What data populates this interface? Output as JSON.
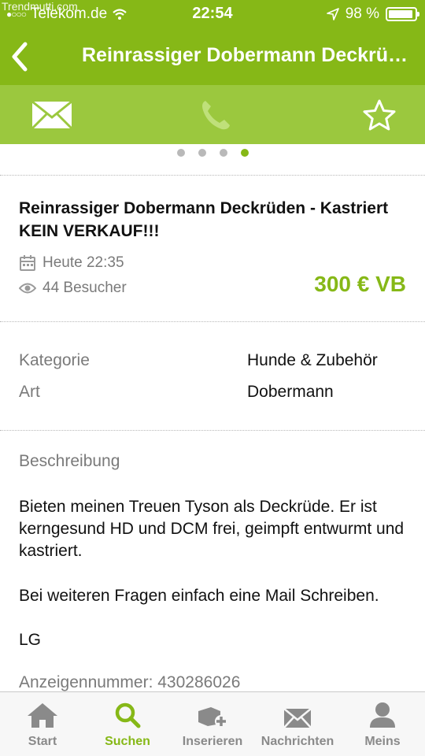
{
  "watermark": "Trendmutti.com",
  "status_bar": {
    "carrier": "Telekom.de",
    "time": "22:54",
    "battery": "98 %"
  },
  "header": {
    "title": "Reinrassiger Dobermann Deckrüden - Kastriert KEIN VERKAUF!!!"
  },
  "action_bar": {
    "icons": [
      "mail-icon",
      "phone-icon",
      "star-icon"
    ]
  },
  "pager": {
    "count": 4,
    "active": 4
  },
  "listing": {
    "title": "Reinrassiger Dobermann Deckrüden - Kastriert KEIN VERKAUF!!!",
    "date": "Heute 22:35",
    "visitors": "44 Besucher",
    "price": "300 € VB"
  },
  "details": [
    {
      "label": "Kategorie",
      "value": "Hunde & Zubehör"
    },
    {
      "label": "Art",
      "value": "Dobermann"
    }
  ],
  "description": {
    "heading": "Beschreibung",
    "paragraph1": "Bieten meinen Treuen Tyson als Deckrüde. Er ist kerngesund HD und DCM frei, geimpft entwurmt und kastriert.",
    "paragraph2": "Bei weiteren Fragen einfach eine Mail Schreiben.",
    "paragraph3": "LG"
  },
  "ad_number": "Anzeigennummer: 430286026",
  "tabs": [
    {
      "label": "Start",
      "icon": "home-icon"
    },
    {
      "label": "Suchen",
      "icon": "search-icon"
    },
    {
      "label": "Inserieren",
      "icon": "post-ad-icon"
    },
    {
      "label": "Nachrichten",
      "icon": "messages-icon"
    },
    {
      "label": "Meins",
      "icon": "profile-icon"
    }
  ],
  "colors": {
    "brand_green": "#86b817",
    "action_bar_green": "#9bc83e",
    "muted_text": "#7a7a7a",
    "inactive_tab": "#8a8a8a"
  }
}
